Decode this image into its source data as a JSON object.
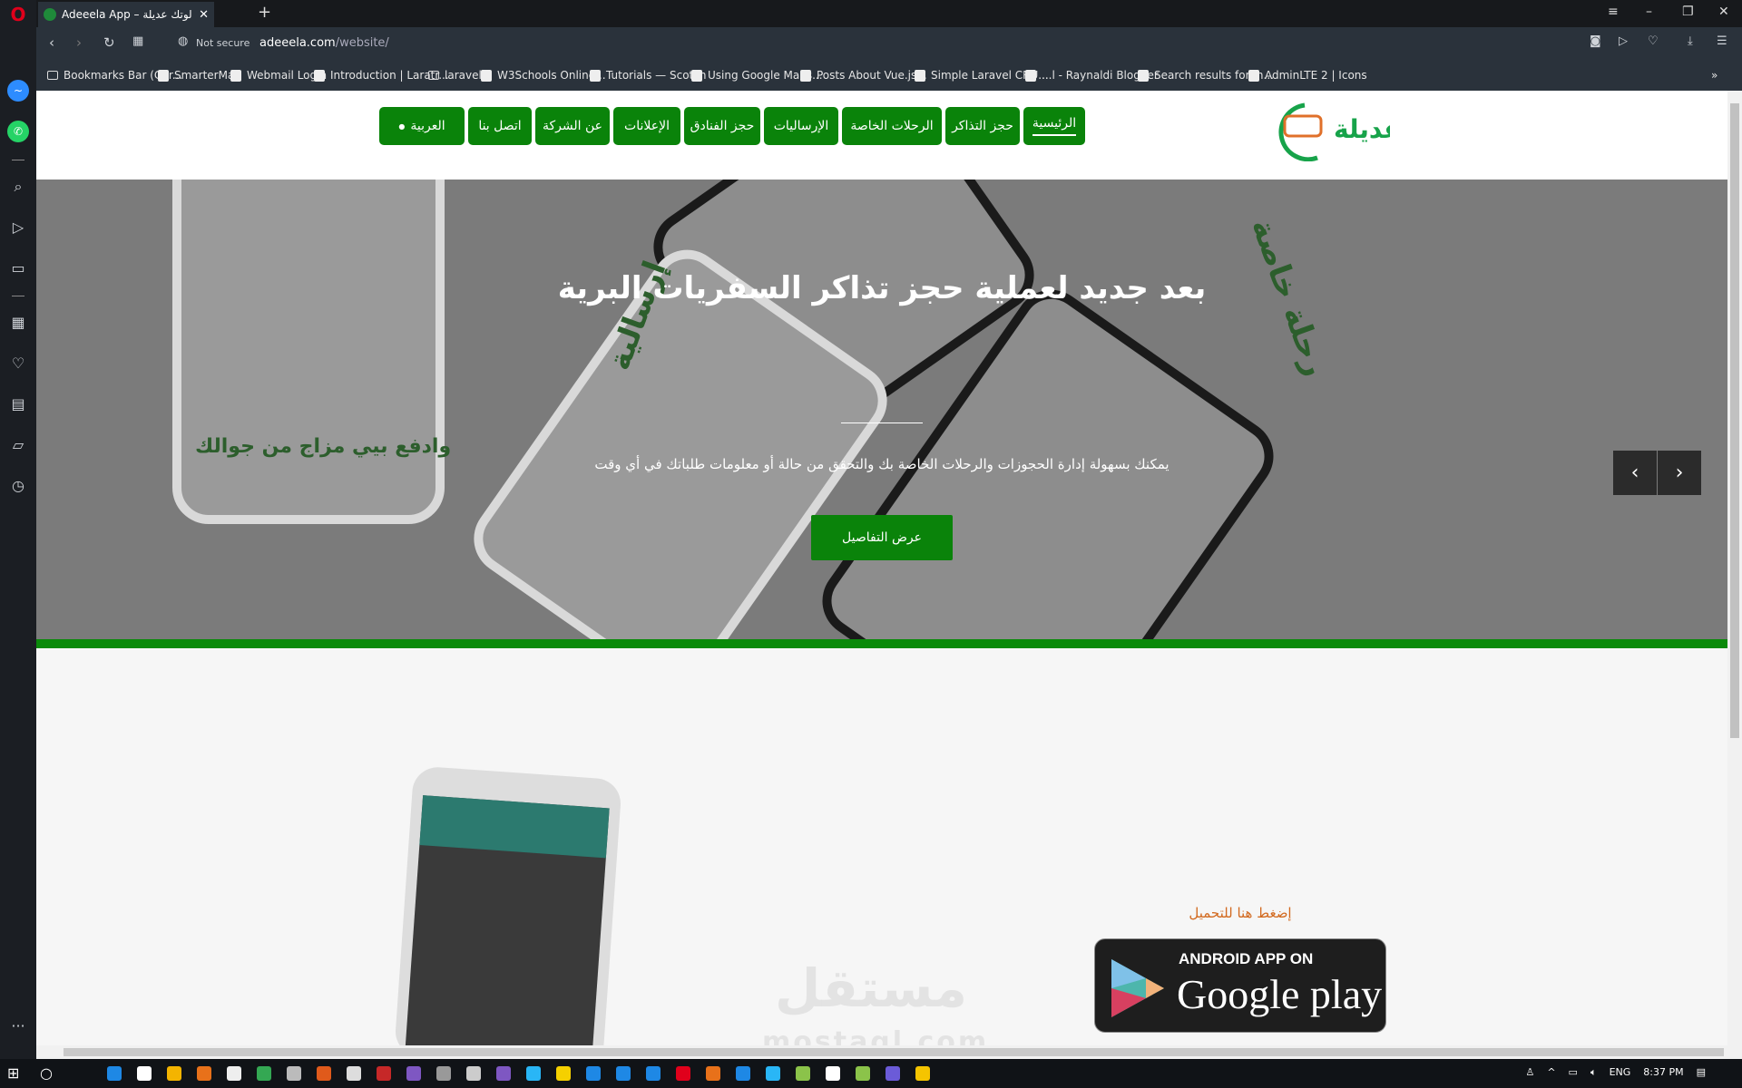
{
  "browser": {
    "tab_title": "Adeeela App – لوتك عديلة",
    "url_security": "Not secure",
    "url_host": "adeeela.com",
    "url_path": "/website/",
    "bookmarks": [
      {
        "label": "Bookmarks Bar (Chr...",
        "icon": "folder-icon"
      },
      {
        "label": "SmarterMail",
        "icon": "mail-icon"
      },
      {
        "label": "Webmail Login",
        "icon": "page-icon"
      },
      {
        "label": "Introduction | Laratr...",
        "icon": "lock-icon"
      },
      {
        "label": "laravel",
        "icon": "folder-icon"
      },
      {
        "label": "W3Schools Online...",
        "icon": "page-icon"
      },
      {
        "label": "Tutorials — Scotch",
        "icon": "scotch-icon"
      },
      {
        "label": "Using Google Maps...",
        "icon": "site-icon"
      },
      {
        "label": "Posts About Vue.js...",
        "icon": "site-icon"
      },
      {
        "label": "Simple Laravel CRU...",
        "icon": "scotch-icon"
      },
      {
        "label": "...l - Raynaldi Blogger",
        "icon": "facebook-icon"
      },
      {
        "label": "Search results for In...",
        "icon": "site-icon"
      },
      {
        "label": "AdminLTE 2 | Icons",
        "icon": "page-icon"
      }
    ],
    "more_bookmarks": "»"
  },
  "site": {
    "logo_text": "عديلة",
    "nav": [
      {
        "label": "الرئيسية",
        "active": true
      },
      {
        "label": "حجز التذاكر"
      },
      {
        "label": "الرحلات الخاصة"
      },
      {
        "label": "الإرساليات"
      },
      {
        "label": "حجز الفنادق"
      },
      {
        "label": "الإعلانات"
      },
      {
        "label": "عن الشركة"
      },
      {
        "label": "اتصل بنا"
      },
      {
        "label": "العربية"
      }
    ],
    "hero": {
      "title": "بعد جديد لعملية حجز تذاكر السفريات البرية",
      "subtitle": "يمكنك بسهولة إدارة الحجوزات والرحلات الخاصة بك والتحقق من حالة أو معلومات طلباتك في أي وقت",
      "button": "عرض التفاصيل",
      "image_text_1": "وادفع بيي مزاج من جوالك",
      "image_text_2": "إرسالية",
      "image_text_3": "رحلة خاصة",
      "slides": 2,
      "active_slide": 2
    },
    "download": {
      "label": "إضغط هنا للتحميل",
      "badge_line1": "ANDROID APP ON",
      "badge_line2": "Google play"
    },
    "watermark": "مستقل",
    "watermark_sub": "mostaql.com"
  },
  "taskbar": {
    "language": "ENG",
    "time": "8:37 PM"
  },
  "colors": {
    "brand_green": "#0a830a",
    "accent_orange": "#d2691e"
  }
}
